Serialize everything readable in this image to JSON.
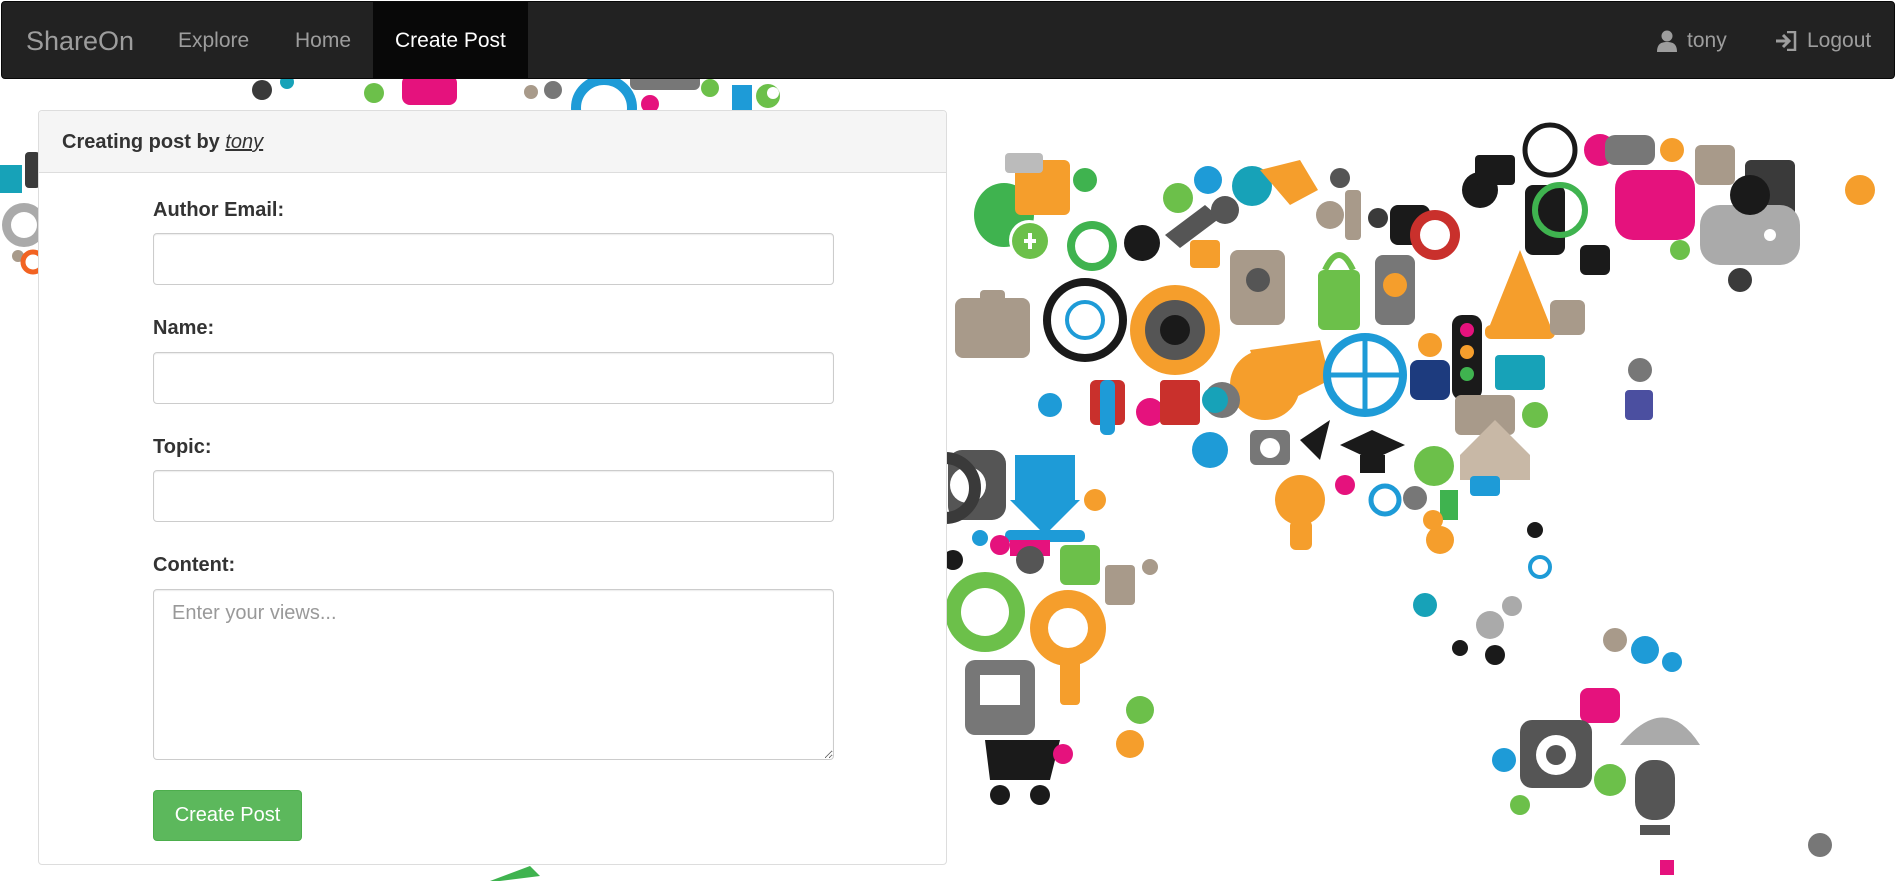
{
  "navbar": {
    "brand": "ShareOn",
    "links": [
      {
        "label": "Explore",
        "active": false
      },
      {
        "label": "Home",
        "active": false
      },
      {
        "label": "Create Post",
        "active": true
      }
    ],
    "user": {
      "label": "tony",
      "icon": "user-icon"
    },
    "logout": {
      "label": "Logout",
      "icon": "log-in-icon"
    }
  },
  "panel": {
    "heading_prefix": "Creating post by",
    "heading_author": "tony"
  },
  "form": {
    "author_email": {
      "label": "Author Email:",
      "value": "",
      "placeholder": ""
    },
    "name": {
      "label": "Name:",
      "value": "",
      "placeholder": ""
    },
    "topic": {
      "label": "Topic:",
      "value": "",
      "placeholder": ""
    },
    "content": {
      "label": "Content:",
      "value": "",
      "placeholder": "Enter your views..."
    },
    "submit_label": "Create Post"
  },
  "colors": {
    "navbar_bg": "#222222",
    "active_tab_bg": "#080808",
    "success": "#5cb85c"
  }
}
